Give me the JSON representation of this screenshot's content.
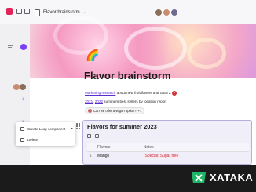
{
  "topbar": {
    "doc_title": "Flavor brainstorm",
    "chevron": "⌄"
  },
  "sidebar": {
    "counts": [
      "1",
      "1"
    ]
  },
  "doc": {
    "emoji": "🌈",
    "title": "Flavor brainstorm",
    "line1_link": "Marketing research",
    "line1_text": " about new fruit flavors and GEN Z",
    "line1_badge": "1",
    "line2_link1": "2021",
    "line2_sep": ", ",
    "line2_link2": "2022",
    "line2_text": " summers best sellers by location report",
    "comment_text": "Can we offer a vegan option?",
    "comment_count": "+1"
  },
  "loop": {
    "title": "Flavors for summer 2023",
    "columns": [
      "Flavors",
      "Notes"
    ],
    "rows": [
      {
        "index": "1",
        "flavor": "Mango",
        "note": "Special: Sugar free"
      }
    ]
  },
  "context_menu": {
    "items": [
      {
        "label": "Create Loop component",
        "icon": "loop-icon"
      },
      {
        "label": "Delete",
        "icon": "trash-icon"
      }
    ],
    "arrow": "▸"
  },
  "brand": {
    "name": "XATAKA",
    "accent": "#1fb566"
  },
  "colors": {
    "loop_border": "#b8acd9",
    "link": "#5b2ccf",
    "tag_bg": "#fde7ea"
  }
}
